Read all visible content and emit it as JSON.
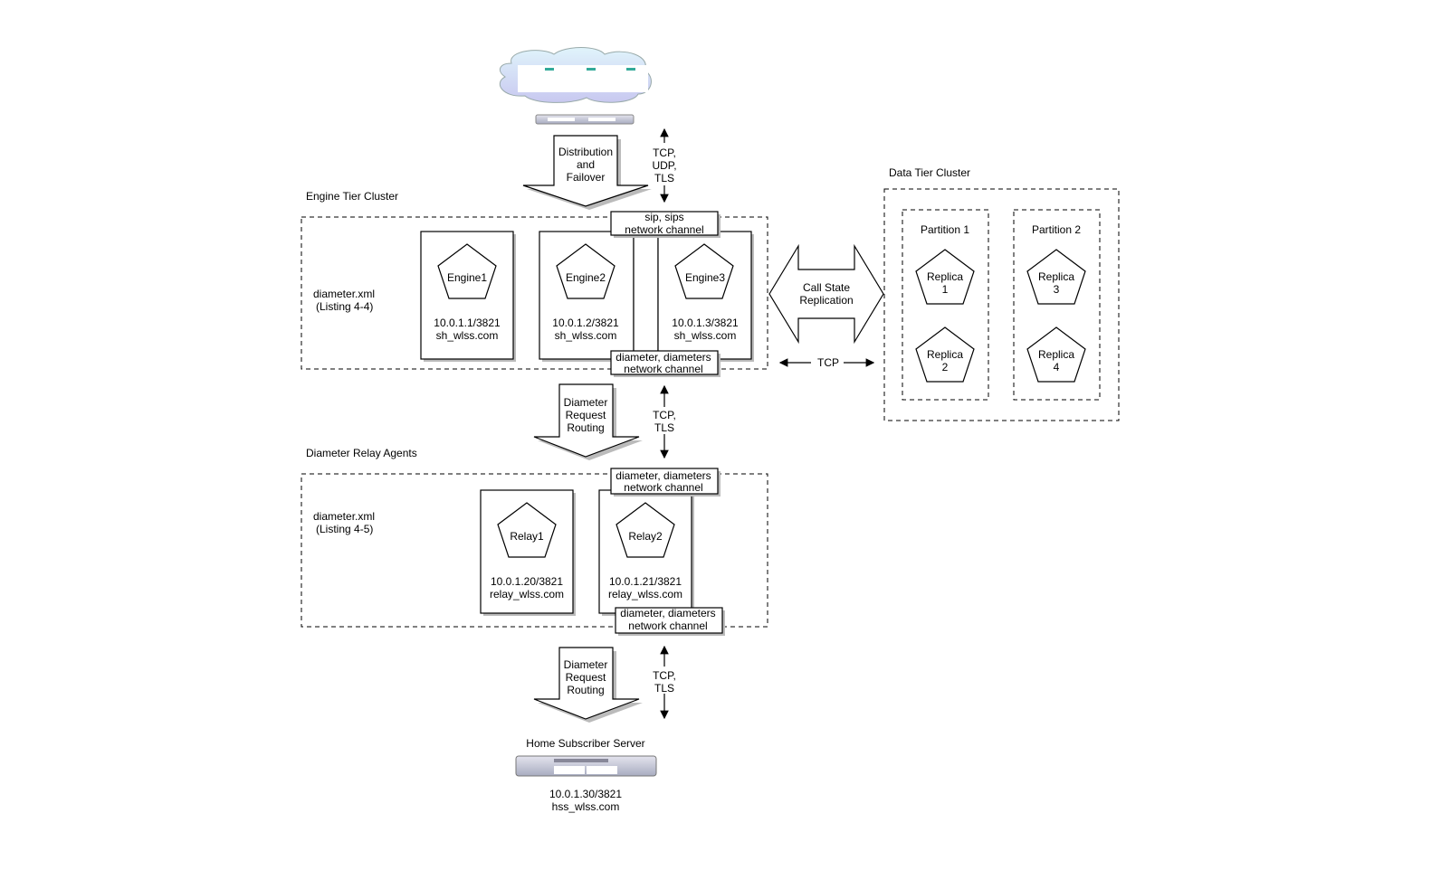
{
  "top_network": {
    "icon": "cloud-with-servers-icon",
    "load_balancer_icon": "rack-server-icon"
  },
  "distribution_arrow": {
    "lines": [
      "Distribution",
      "and",
      "Failover"
    ]
  },
  "top_protocols": [
    "TCP,",
    "UDP,",
    "TLS"
  ],
  "engine_tier": {
    "title": "Engine Tier Cluster",
    "config": [
      "diameter.xml",
      "(Listing 4-4)"
    ],
    "sip_channel": [
      "sip, sips",
      "network channel"
    ],
    "diameter_channel": [
      "diameter, diameters",
      "network channel"
    ],
    "engines": [
      {
        "name": "Engine1",
        "address": "10.0.1.1/3821",
        "host": "sh_wlss.com"
      },
      {
        "name": "Engine2",
        "address": "10.0.1.2/3821",
        "host": "sh_wlss.com"
      },
      {
        "name": "Engine3",
        "address": "10.0.1.3/3821",
        "host": "sh_wlss.com"
      }
    ]
  },
  "replication_arrow": {
    "lines": [
      "Call State",
      "Replication"
    ]
  },
  "replication_protocol": "TCP",
  "data_tier": {
    "title": "Data Tier Cluster",
    "partitions": [
      {
        "name": "Partition 1",
        "replicas": [
          [
            "Replica",
            "1"
          ],
          [
            "Replica",
            "2"
          ]
        ]
      },
      {
        "name": "Partition 2",
        "replicas": [
          [
            "Replica",
            "3"
          ],
          [
            "Replica",
            "4"
          ]
        ]
      }
    ]
  },
  "routing_arrow_1": {
    "lines": [
      "Diameter",
      "Request",
      "Routing"
    ]
  },
  "middle_protocols": [
    "TCP,",
    "TLS"
  ],
  "relay_agents": {
    "title": "Diameter Relay Agents",
    "config": [
      "diameter.xml",
      "(Listing 4-5)"
    ],
    "top_channel": [
      "diameter, diameters",
      "network channel"
    ],
    "bottom_channel": [
      "diameter, diameters",
      "network channel"
    ],
    "relays": [
      {
        "name": "Relay1",
        "address": "10.0.1.20/3821",
        "host": "relay_wlss.com"
      },
      {
        "name": "Relay2",
        "address": "10.0.1.21/3821",
        "host": "relay_wlss.com"
      }
    ]
  },
  "routing_arrow_2": {
    "lines": [
      "Diameter",
      "Request",
      "Routing"
    ]
  },
  "bottom_protocols": [
    "TCP,",
    "TLS"
  ],
  "hss": {
    "title": "Home Subscriber Server",
    "address": "10.0.1.30/3821",
    "host": "hss_wlss.com",
    "icon": "rack-server-icon"
  }
}
